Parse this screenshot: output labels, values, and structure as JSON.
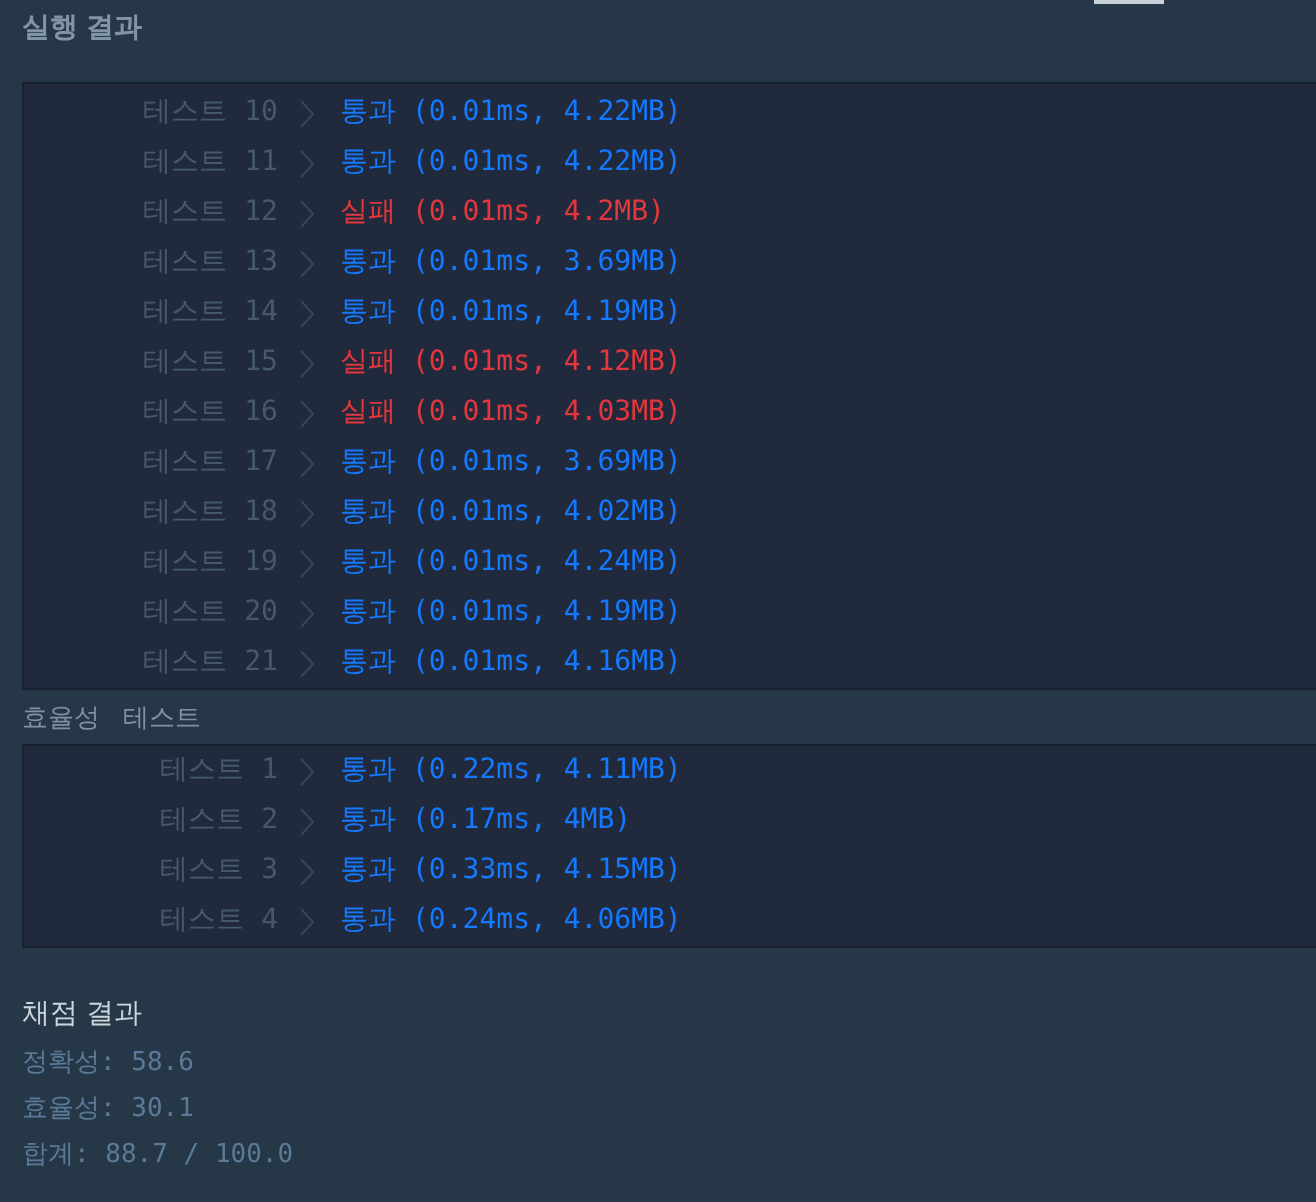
{
  "header": {
    "title": "실행 결과"
  },
  "accuracy_tests": [
    {
      "label": "테스트 10",
      "status": "통과",
      "result": "(0.01ms, 4.22MB)",
      "passed": true
    },
    {
      "label": "테스트 11",
      "status": "통과",
      "result": "(0.01ms, 4.22MB)",
      "passed": true
    },
    {
      "label": "테스트 12",
      "status": "실패",
      "result": "(0.01ms, 4.2MB)",
      "passed": false
    },
    {
      "label": "테스트 13",
      "status": "통과",
      "result": "(0.01ms, 3.69MB)",
      "passed": true
    },
    {
      "label": "테스트 14",
      "status": "통과",
      "result": "(0.01ms, 4.19MB)",
      "passed": true
    },
    {
      "label": "테스트 15",
      "status": "실패",
      "result": "(0.01ms, 4.12MB)",
      "passed": false
    },
    {
      "label": "테스트 16",
      "status": "실패",
      "result": "(0.01ms, 4.03MB)",
      "passed": false
    },
    {
      "label": "테스트 17",
      "status": "통과",
      "result": "(0.01ms, 3.69MB)",
      "passed": true
    },
    {
      "label": "테스트 18",
      "status": "통과",
      "result": "(0.01ms, 4.02MB)",
      "passed": true
    },
    {
      "label": "테스트 19",
      "status": "통과",
      "result": "(0.01ms, 4.24MB)",
      "passed": true
    },
    {
      "label": "테스트 20",
      "status": "통과",
      "result": "(0.01ms, 4.19MB)",
      "passed": true
    },
    {
      "label": "테스트 21",
      "status": "통과",
      "result": "(0.01ms, 4.16MB)",
      "passed": true
    }
  ],
  "efficiency_section": {
    "title": "효율성 테스트"
  },
  "efficiency_tests": [
    {
      "label": "테스트 1",
      "status": "통과",
      "result": "(0.22ms, 4.11MB)",
      "passed": true
    },
    {
      "label": "테스트 2",
      "status": "통과",
      "result": "(0.17ms, 4MB)",
      "passed": true
    },
    {
      "label": "테스트 3",
      "status": "통과",
      "result": "(0.33ms, 4.15MB)",
      "passed": true
    },
    {
      "label": "테스트 4",
      "status": "통과",
      "result": "(0.24ms, 4.06MB)",
      "passed": true
    }
  ],
  "score": {
    "title": "채점 결과",
    "lines": [
      "정확성: 58.6",
      "효율성: 30.1",
      "합계: 88.7 / 100.0"
    ]
  }
}
